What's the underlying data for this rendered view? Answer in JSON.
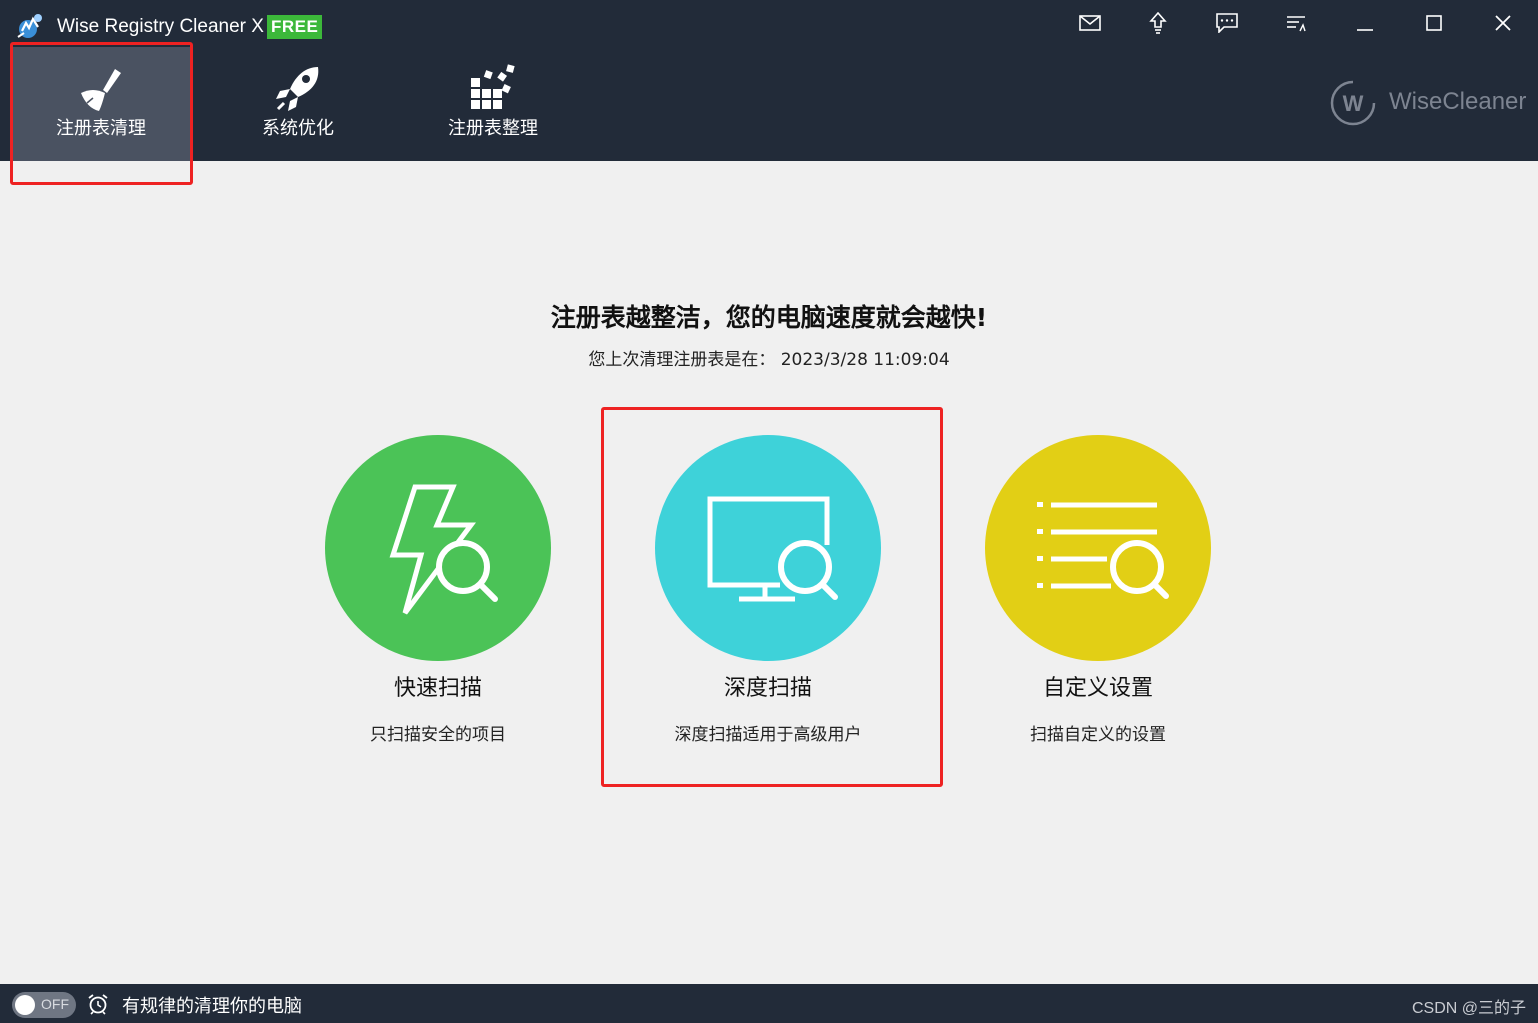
{
  "window": {
    "title": "Wise Registry Cleaner X",
    "badge": "FREE",
    "controls": [
      "mail-icon",
      "upgrade-icon",
      "feedback-icon",
      "menu-icon",
      "minimize-icon",
      "maximize-icon",
      "close-icon"
    ]
  },
  "nav": {
    "tabs": [
      {
        "label": "注册表清理",
        "icon": "broom-icon",
        "active": true
      },
      {
        "label": "系统优化",
        "icon": "rocket-icon",
        "active": false
      },
      {
        "label": "注册表整理",
        "icon": "defrag-blocks-icon",
        "active": false
      }
    ]
  },
  "brand": {
    "logo_letter": "W",
    "text": "WiseCleaner"
  },
  "main": {
    "headline": "注册表越整洁，您的电脑速度就会越快!",
    "last_clean_label": "您上次清理注册表是在：",
    "last_clean_time": "2023/3/28 11:09:04"
  },
  "scan_options": [
    {
      "title": "快速扫描",
      "desc": "只扫描安全的项目",
      "icon": "lightning-search-icon",
      "color": "#4bc357"
    },
    {
      "title": "深度扫描",
      "desc": "深度扫描适用于高级用户",
      "icon": "monitor-search-icon",
      "color": "#3ed2d9"
    },
    {
      "title": "自定义设置",
      "desc": "扫描自定义的设置",
      "icon": "list-search-icon",
      "color": "#e2cf15"
    }
  ],
  "footer": {
    "toggle_text": "OFF",
    "schedule_text": "有规律的清理你的电脑",
    "watermark": "CSDN @三的子"
  },
  "colors": {
    "header_bg": "#222b39",
    "active_tab_bg": "#4a5261",
    "content_bg": "#f0f0f0",
    "free_badge": "#3cb83a",
    "annotation": "#ee2222"
  }
}
